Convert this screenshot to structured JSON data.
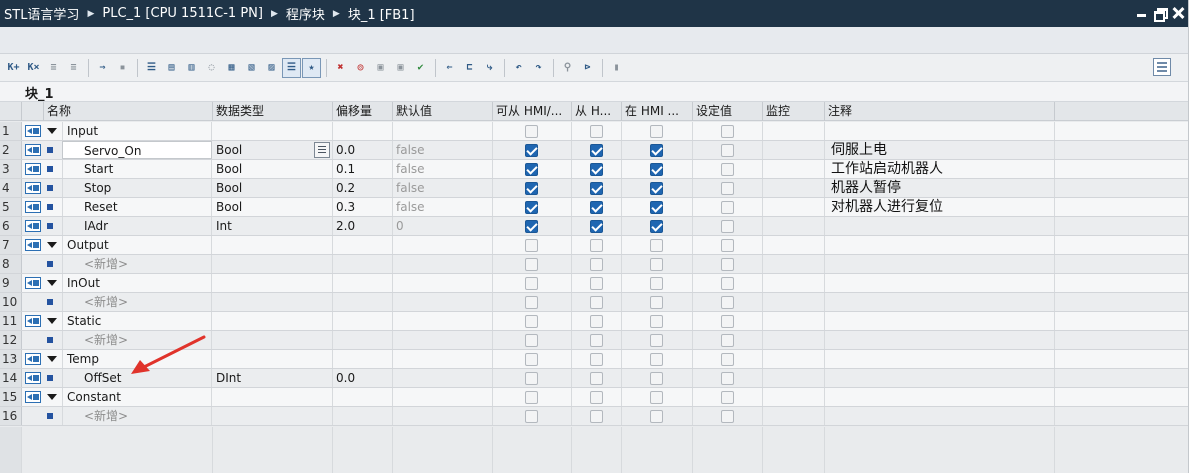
{
  "titlebar": {
    "crumbs": [
      "STL语言学习",
      "PLC_1 [CPU 1511C-1 PN]",
      "程序块",
      "块_1 [FB1]"
    ]
  },
  "toolbar": {
    "icons": [
      "add-row-icon",
      "delete-row-icon",
      "indent-icon",
      "outdent-icon",
      "download-icon",
      "monitor-icon",
      "network-view-icon",
      "block-interface-icon",
      "block-edit-icon",
      "comment-icon",
      "insert-network-icon",
      "insert-row-icon",
      "insert-block-icon",
      "list-view-icon",
      "favorites-icon",
      "remove-all-icon",
      "snapshot-icon",
      "monitor-glasses-icon",
      "compare-icon",
      "loadstart-icon",
      "jump-icon",
      "call-icon",
      "branch-icon",
      "undo-icon",
      "redo-icon",
      "watch-icon",
      "force-icon",
      "memory-icon"
    ],
    "right_icon": "layout-toggle-icon"
  },
  "block": {
    "caption": "块_1"
  },
  "table": {
    "headers": {
      "name": "名称",
      "type": "数据类型",
      "offset": "偏移量",
      "default": "默认值",
      "hmi_access": "可从 HMI/...",
      "hmi_from": "从 H...",
      "hmi_in": "在 HMI ...",
      "setpoint": "设定值",
      "monitor": "监控",
      "comment": "注释"
    },
    "rows": [
      {
        "no": "1",
        "kind": "section",
        "name": "Input",
        "type": "",
        "offset": "",
        "default": "",
        "c1": false,
        "c2": false,
        "c3": false,
        "comment": ""
      },
      {
        "no": "2",
        "kind": "item",
        "name": "Servo_On",
        "type": "Bool",
        "offset": "0.0",
        "default": "false",
        "c1": true,
        "c2": true,
        "c3": true,
        "comment": "伺服上电"
      },
      {
        "no": "3",
        "kind": "item",
        "name": "Start",
        "type": "Bool",
        "offset": "0.1",
        "default": "false",
        "c1": true,
        "c2": true,
        "c3": true,
        "comment": "工作站启动机器人"
      },
      {
        "no": "4",
        "kind": "item",
        "name": "Stop",
        "type": "Bool",
        "offset": "0.2",
        "default": "false",
        "c1": true,
        "c2": true,
        "c3": true,
        "comment": "机器人暂停"
      },
      {
        "no": "5",
        "kind": "item",
        "name": "Reset",
        "type": "Bool",
        "offset": "0.3",
        "default": "false",
        "c1": true,
        "c2": true,
        "c3": true,
        "comment": "对机器人进行复位"
      },
      {
        "no": "6",
        "kind": "item",
        "name": "IAdr",
        "type": "Int",
        "offset": "2.0",
        "default": "0",
        "c1": true,
        "c2": true,
        "c3": true,
        "comment": ""
      },
      {
        "no": "7",
        "kind": "section",
        "name": "Output",
        "type": "",
        "offset": "",
        "default": "",
        "c1": false,
        "c2": false,
        "c3": false,
        "comment": ""
      },
      {
        "no": "8",
        "kind": "new",
        "name": "<新增>",
        "type": "",
        "offset": "",
        "default": "",
        "c1": false,
        "c2": false,
        "c3": false,
        "comment": ""
      },
      {
        "no": "9",
        "kind": "section",
        "name": "InOut",
        "type": "",
        "offset": "",
        "default": "",
        "c1": false,
        "c2": false,
        "c3": false,
        "comment": ""
      },
      {
        "no": "10",
        "kind": "new",
        "name": "<新增>",
        "type": "",
        "offset": "",
        "default": "",
        "c1": false,
        "c2": false,
        "c3": false,
        "comment": ""
      },
      {
        "no": "11",
        "kind": "section",
        "name": "Static",
        "type": "",
        "offset": "",
        "default": "",
        "c1": false,
        "c2": false,
        "c3": false,
        "comment": ""
      },
      {
        "no": "12",
        "kind": "new",
        "name": "<新增>",
        "type": "",
        "offset": "",
        "default": "",
        "c1": false,
        "c2": false,
        "c3": false,
        "comment": ""
      },
      {
        "no": "13",
        "kind": "section",
        "name": "Temp",
        "type": "",
        "offset": "",
        "default": "",
        "c1": false,
        "c2": false,
        "c3": false,
        "comment": ""
      },
      {
        "no": "14",
        "kind": "item",
        "name": "OffSet",
        "type": "DInt",
        "offset": "0.0",
        "default": "",
        "c1": false,
        "c2": false,
        "c3": false,
        "comment": ""
      },
      {
        "no": "15",
        "kind": "section",
        "name": "Constant",
        "type": "",
        "offset": "",
        "default": "",
        "c1": false,
        "c2": false,
        "c3": false,
        "comment": ""
      },
      {
        "no": "16",
        "kind": "new",
        "name": "<新增>",
        "type": "",
        "offset": "",
        "default": "",
        "c1": false,
        "c2": false,
        "c3": false,
        "comment": ""
      }
    ]
  },
  "colors": {
    "titlebar_bg": "#1f3447",
    "checkbox_checked": "#1f66b1",
    "annotation_arrow": "#e0332b"
  }
}
